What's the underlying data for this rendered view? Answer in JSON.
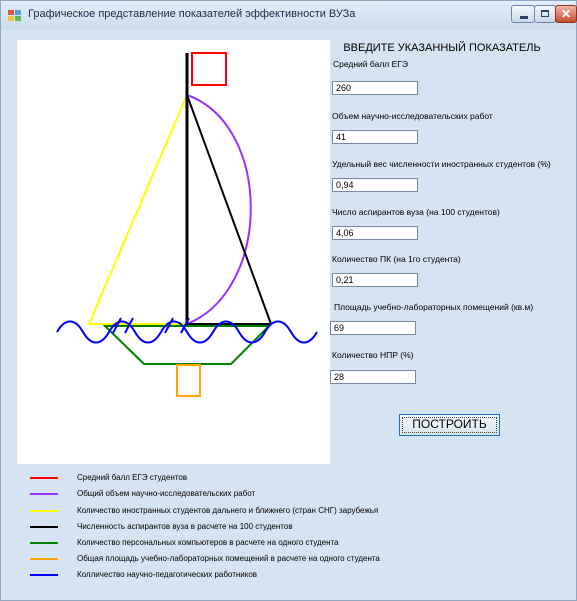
{
  "window": {
    "title": "Графическое представление показателей эффективности ВУЗа",
    "close_glyph": "✕"
  },
  "form": {
    "heading": "ВВЕДИТЕ УКАЗАННЫЙ ПОКАЗАТЕЛЬ",
    "fields": [
      {
        "label": "Средний балл ЕГЭ",
        "value": "260"
      },
      {
        "label": "Объем научно-исследовательских работ",
        "value": "41"
      },
      {
        "label": "Удельный вес численности иностранных студентов (%)",
        "value": "0,94"
      },
      {
        "label": "Число аспирантов вуза (на 100 студентов)",
        "value": "4,06"
      },
      {
        "label": "Количество ПК (на 1го студента)",
        "value": "0,21"
      },
      {
        "label": "Площадь учебно-лабораторных помещений (кв.м)",
        "value": "69"
      },
      {
        "label": "Количество НПР (%)",
        "value": "28"
      }
    ],
    "build_label": "ПОСТРОИТЬ"
  },
  "legend": [
    {
      "color": "#ff0000",
      "text": "Средний балл ЕГЭ студентов"
    },
    {
      "color": "#9b30ff",
      "text": "Общий объем научно-исследовательских работ"
    },
    {
      "color": "#ffff00",
      "text": "Количество иностранных студентов дальнего и ближнего (стран СНГ) зарубежья"
    },
    {
      "color": "#000000",
      "text": "Численность аспирантов вуза в расчете на 100 студентов"
    },
    {
      "color": "#008000",
      "text": "Количество персональных компьютеров в расчете на одного студента"
    },
    {
      "color": "#ffa500",
      "text": "Общая площадь учебно-лабораторных помещений в расчете на одного студента"
    },
    {
      "color": "#0000ff",
      "text": "Колличество научно-педагогических работников"
    }
  ]
}
